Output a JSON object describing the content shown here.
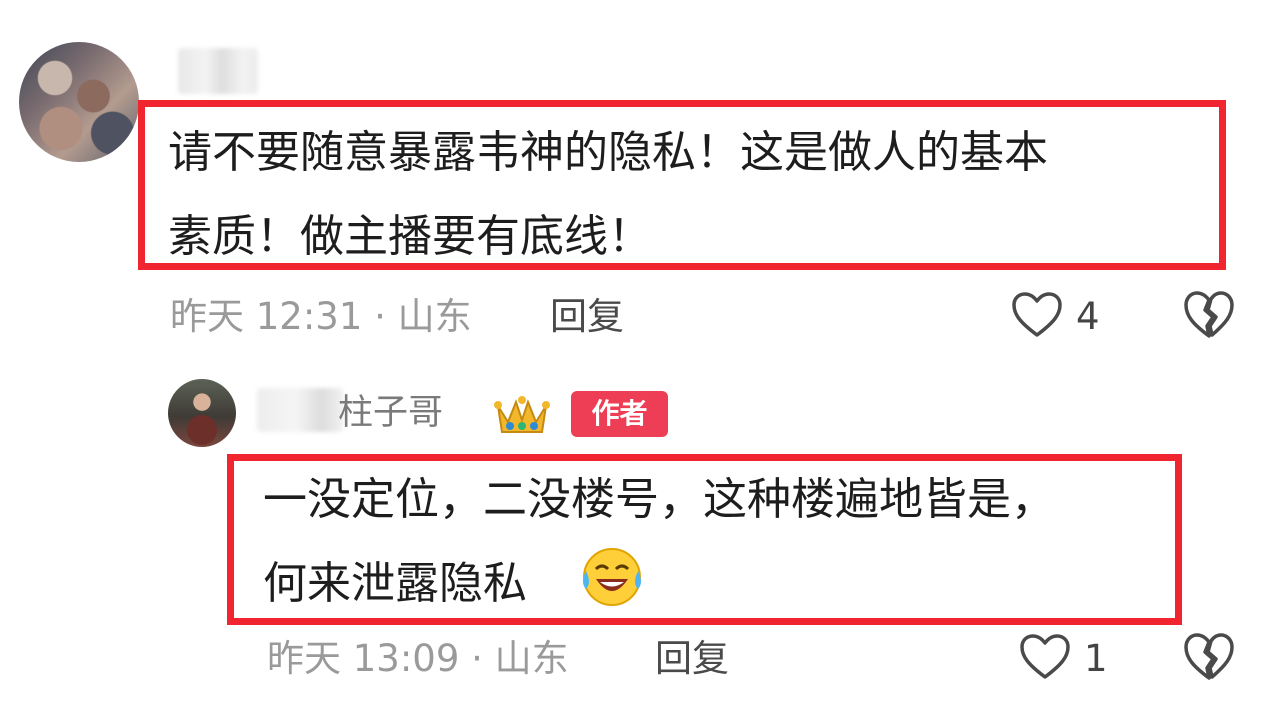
{
  "comments": [
    {
      "text_line1": "请不要随意暴露韦神的隐私！这是做人的基本",
      "text_line2": "素质！做主播要有底线！",
      "time": "昨天 12:31 · 山东",
      "reply_label": "回复",
      "like_count": "4"
    },
    {
      "author_name": "柱子哥",
      "author_badge": "作者",
      "text_line1": "一没定位，二没楼号，这种楼遍地皆是，",
      "text_line2": "何来泄露隐私",
      "time": "昨天 13:09 · 山东",
      "reply_label": "回复",
      "like_count": "1"
    }
  ],
  "icons": {
    "like": "heart-outline-icon",
    "dislike": "broken-heart-icon",
    "crown": "crown-emoji-icon",
    "laugh": "laughing-emoji-icon"
  },
  "colors": {
    "highlight_border": "#f0252f",
    "author_badge": "#ee3e56",
    "muted_text": "#9a9a9a"
  }
}
